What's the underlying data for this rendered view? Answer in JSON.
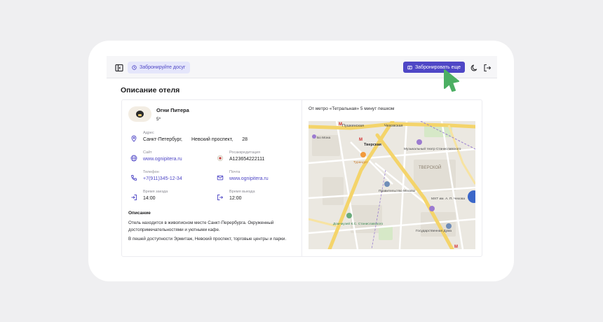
{
  "toolbar": {
    "chip_label": "Забронируйте досуг",
    "primary_label": "Забронировать еще"
  },
  "page": {
    "title": "Описание отеля"
  },
  "hotel": {
    "name": "Огни Питера",
    "stars": "5*",
    "address": {
      "label": "Адрес",
      "city": "Санкт-Петербург,",
      "street": "Невский проспект,",
      "number": "28"
    },
    "site": {
      "label": "Сайт",
      "value": "www.ognipitera.ru"
    },
    "accreditation": {
      "label": "Росаккредитация",
      "value": "A123654222111"
    },
    "phone": {
      "label": "Телефон",
      "value": "+7(911)345-12-34"
    },
    "email": {
      "label": "Почта",
      "value": "www.ognipitera.ru"
    },
    "checkin": {
      "label": "Время заезда",
      "value": "14:00"
    },
    "checkout": {
      "label": "Время выезда",
      "value": "12:00"
    },
    "description": {
      "title": "Описание",
      "p1": "Отель находится в живописном месте Санкт-Перербурга. Окруженный достопримечательностями и уютными кафе.",
      "p2": "В пешей доступности Эрмитаж, Невский проспект, торговые центры и парки."
    }
  },
  "location": {
    "metro_text": "От метро «Тетральная» 5 минут пешком",
    "map_labels": {
      "pushkinskaya": "Пушкинская",
      "chekhovskaya": "Чеховская",
      "tverskaya": "Тверская",
      "tverskoy": "ТВЕРСКОЙ",
      "theatre": "Музыкальный театр Станиславского",
      "government": "Правительство Москвы",
      "mkhat": "МХТ им. А. П. Чехова",
      "duma": "Государственная Дума",
      "dom_muzei": "Дом-музей К.С. Станиславского",
      "turandot": "Турандот",
      "bo_mona": "Бо Мона"
    }
  },
  "colors": {
    "accent": "#4f47c6",
    "chip_bg": "#e5e6fb",
    "cursor": "#4caf63"
  }
}
